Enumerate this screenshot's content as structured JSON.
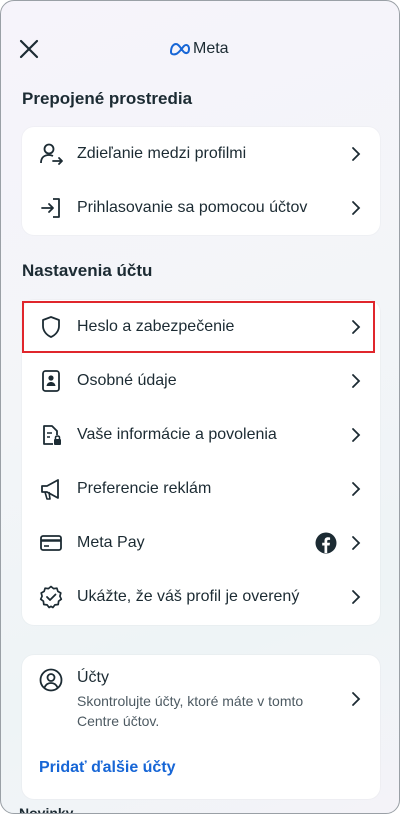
{
  "header": {
    "brand": "Meta"
  },
  "sections": {
    "connected": {
      "title": "Prepojené prostredia",
      "items": [
        {
          "label": "Zdieľanie medzi profilmi",
          "icon": "share-profiles-icon"
        },
        {
          "label": "Prihlasovanie sa pomocou účtov",
          "icon": "login-arrow-icon"
        }
      ]
    },
    "settings": {
      "title": "Nastavenia účtu",
      "items": [
        {
          "label": "Heslo a zabezpečenie",
          "icon": "shield-icon"
        },
        {
          "label": "Osobné údaje",
          "icon": "id-card-icon"
        },
        {
          "label": "Vaše informácie a povolenia",
          "icon": "document-lock-icon"
        },
        {
          "label": "Preferencie reklám",
          "icon": "megaphone-icon"
        },
        {
          "label": "Meta Pay",
          "icon": "credit-card-icon",
          "badge_icon": "facebook-icon"
        },
        {
          "label": "Ukážte, že váš profil je overený",
          "icon": "verified-badge-icon"
        }
      ]
    },
    "accounts": {
      "title": "Účty",
      "description": "Skontrolujte účty, ktoré máte v tomto Centre účtov.",
      "add_link": "Pridať ďalšie účty",
      "icon": "account-circle-icon"
    }
  },
  "peek_text": "Novinky",
  "colors": {
    "link": "#1766d6",
    "highlight": "#e0262c",
    "text": "#1c2b33",
    "facebook": "#1c2b33"
  }
}
